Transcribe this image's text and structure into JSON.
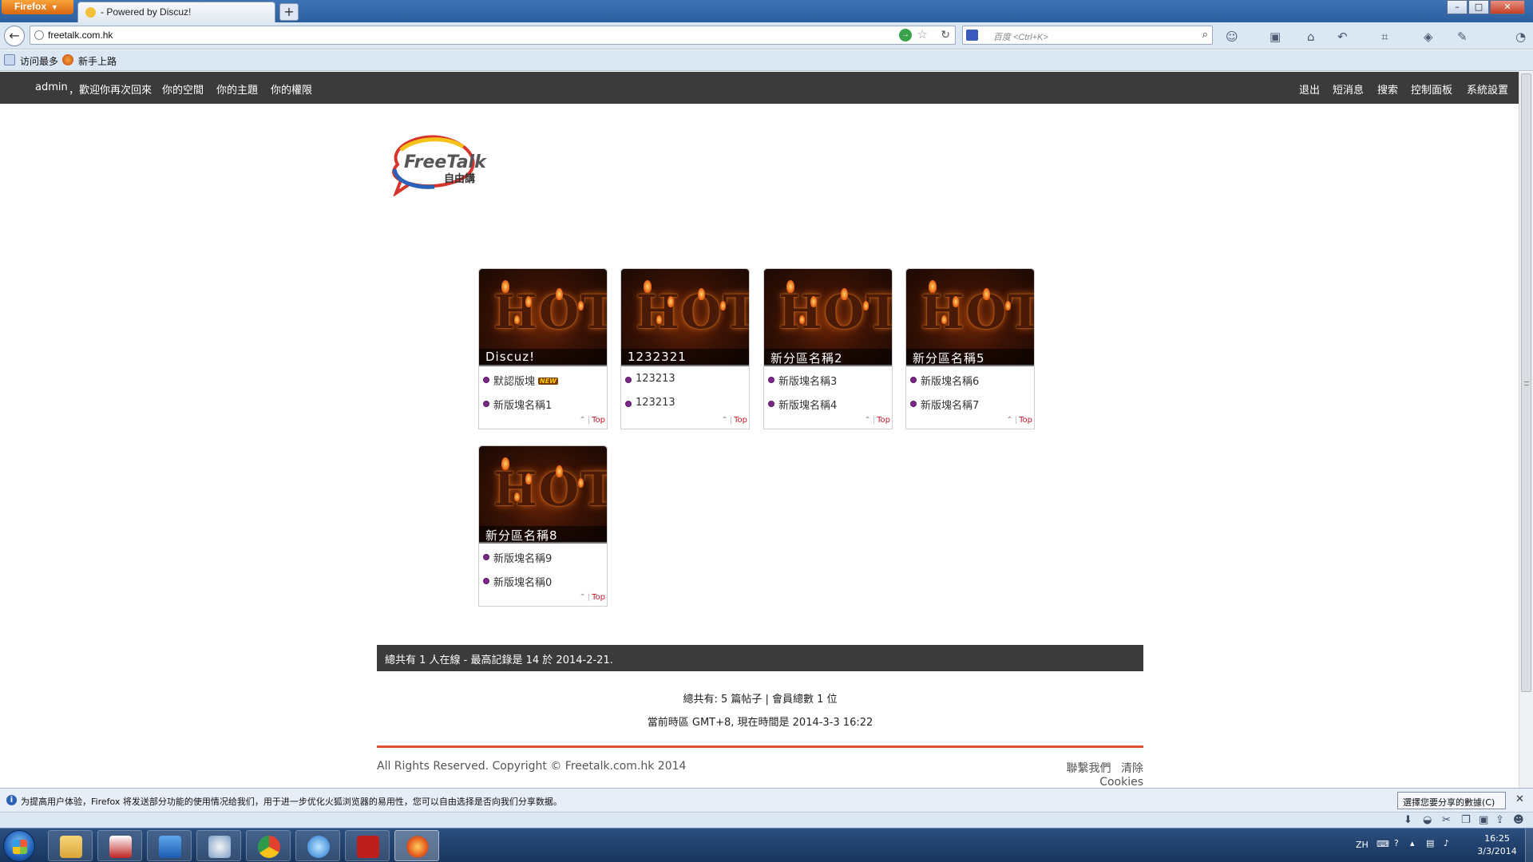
{
  "browser": {
    "app_button": "Firefox",
    "tab_title": "- Powered by Discuz!",
    "url": "freetalk.com.hk",
    "search_placeholder": "百度 <Ctrl+K>",
    "bookmarks": [
      "访问最多",
      "新手上路"
    ],
    "window_controls": [
      "–",
      "□",
      "✕"
    ]
  },
  "site_nav": {
    "user": "admin",
    "welcome": "，歡迎你再次回來",
    "left_links": [
      "你的空間",
      "你的主題",
      "你的權限"
    ],
    "right_links": [
      "退出",
      "短消息",
      "搜索",
      "控制面板",
      "系統設置"
    ]
  },
  "logo": {
    "text_main": "FreeTalk",
    "text_sub": "自由講"
  },
  "forums": [
    {
      "title": "Discuz!",
      "boards": [
        "默認版塊",
        "新版塊名稱1"
      ],
      "new_badge": "NEW",
      "badge_on": 0
    },
    {
      "title": "1232321",
      "boards": [
        "123213",
        "123213"
      ]
    },
    {
      "title": "新分區名稱2",
      "boards": [
        "新版塊名稱3",
        "新版塊名稱4"
      ]
    },
    {
      "title": "新分區名稱5",
      "boards": [
        "新版塊名稱6",
        "新版塊名稱7"
      ]
    },
    {
      "title": "新分區名稱8",
      "boards": [
        "新版塊名稱9",
        "新版塊名稱0"
      ]
    }
  ],
  "hot_image_text": "HOT",
  "top_link": "Top",
  "footer": {
    "online": "總共有 1 人在線 - 最高記錄是 14 於 2014-2-21.",
    "stats_line": "總共有: 5 篇帖子 | 會員總數 1 位",
    "time_line": "當前時區 GMT+8, 現在時間是 2014-3-3 16:22",
    "copyright": "All Rights Reserved. Copyright © Freetalk.com.hk 2014",
    "links": [
      "聯繫我們",
      "清除 Cookies"
    ]
  },
  "notification": {
    "text": "为提高用户体验，Firefox 将发送部分功能的使用情况给我们，用于进一步优化火狐浏览器的易用性，您可以自由选择是否向我们分享数据。",
    "button": "選擇您要分享的數據(C)"
  },
  "taskbar": {
    "language": "ZH",
    "time": "16:25",
    "date": "3/3/2014"
  },
  "colors": {
    "nav_bg": "#3b3b3b",
    "accent_red": "#d9532c",
    "top_link": "#c2192c"
  }
}
